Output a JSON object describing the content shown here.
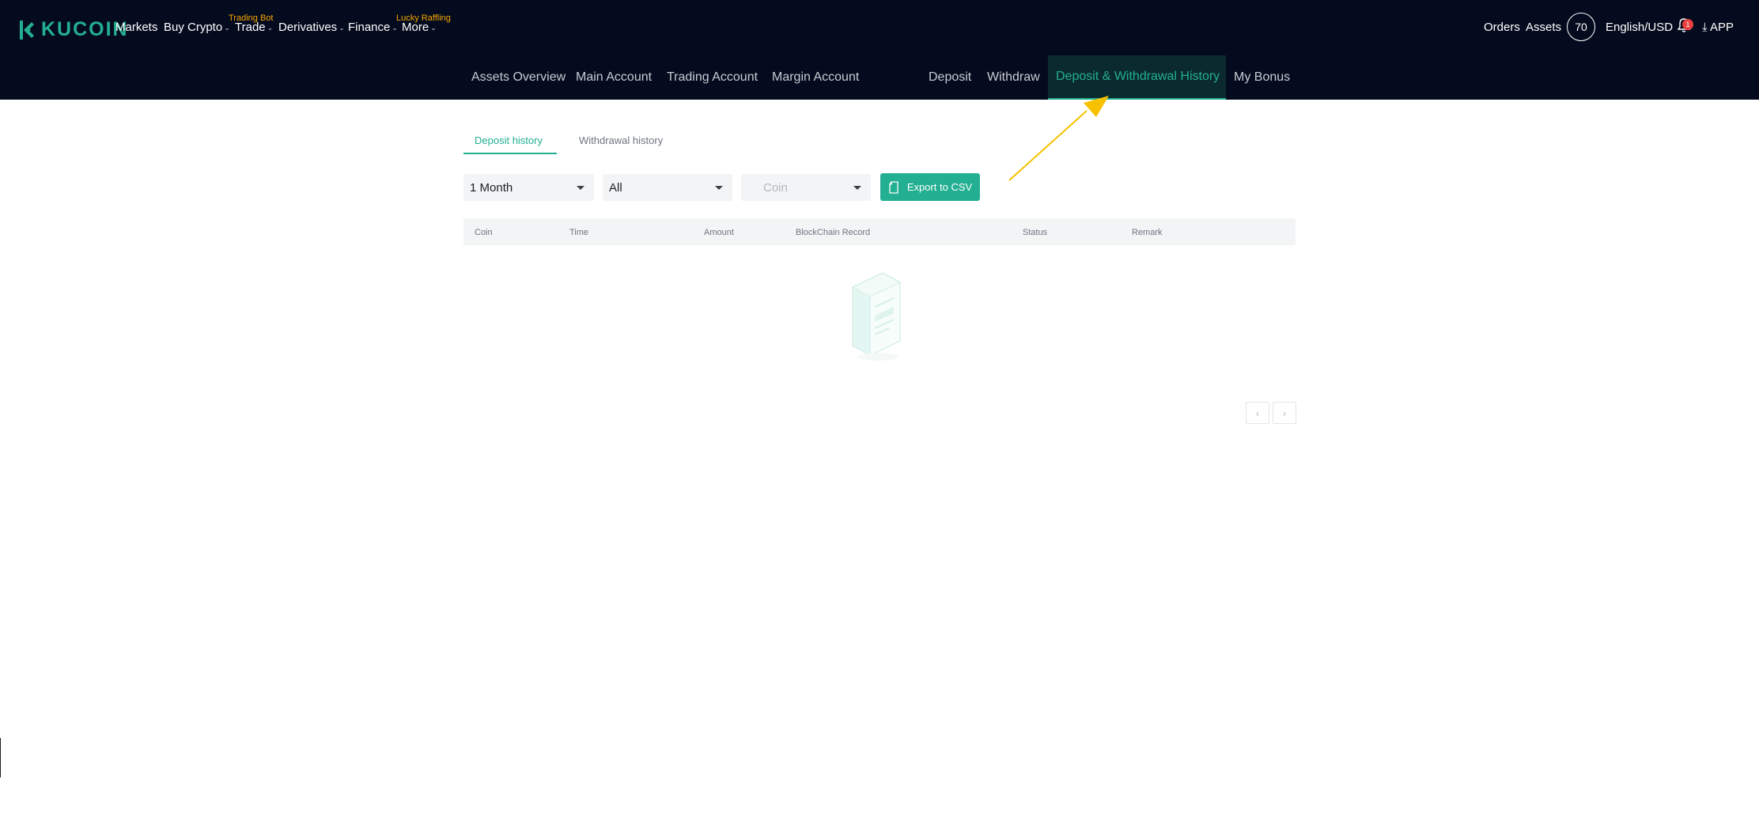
{
  "header": {
    "brand": "KUCOIN",
    "nav": [
      {
        "label": "Markets",
        "caret": false
      },
      {
        "label": "Buy Crypto",
        "caret": true
      },
      {
        "label": "Trade",
        "caret": true
      },
      {
        "label": "Derivatives",
        "caret": true
      },
      {
        "label": "Finance",
        "caret": true
      },
      {
        "label": "More",
        "caret": true
      }
    ],
    "promos": {
      "trade": "Trading Bot",
      "more": "Lucky Raffling"
    },
    "right": {
      "orders": "Orders",
      "assets": "Assets",
      "avatar": "70",
      "locale": "English/USD",
      "notification_count": "1",
      "app": "APP"
    }
  },
  "subnav": {
    "items": [
      "Assets Overview",
      "Main Account",
      "Trading Account",
      "Margin Account",
      "Deposit",
      "Withdraw",
      "Deposit & Withdrawal History",
      "My Bonus"
    ],
    "active": "Deposit & Withdrawal History"
  },
  "tabs": [
    {
      "label": "Deposit history",
      "active": true
    },
    {
      "label": "Withdrawal history",
      "active": false
    }
  ],
  "filters": {
    "period": "1 Month",
    "type": "All",
    "coin_placeholder": "Coin"
  },
  "export_label": "Export to CSV",
  "table": {
    "columns": [
      "Coin",
      "Time",
      "Amount",
      "BlockChain Record",
      "Status",
      "Remark"
    ],
    "rows": []
  },
  "pager": {
    "prev": "‹",
    "next": "›"
  },
  "colors": {
    "accent": "#23af91",
    "header_bg": "#050b1e",
    "promo": "#f7a600",
    "annotation": "#f7c100"
  }
}
